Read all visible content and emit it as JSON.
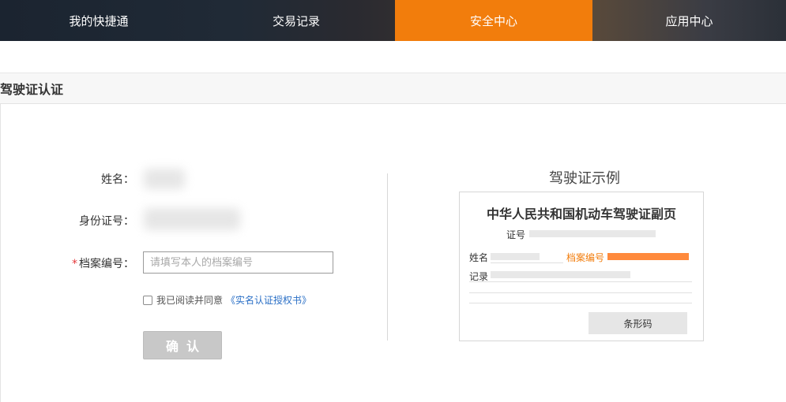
{
  "nav": {
    "tabs": [
      {
        "label": "我的快捷通"
      },
      {
        "label": "交易记录"
      },
      {
        "label": "安全中心"
      },
      {
        "label": "应用中心"
      }
    ],
    "active_index": 2,
    "active_color": "#f27d0c"
  },
  "section": {
    "title": "驾驶证认证"
  },
  "form": {
    "name_label": "姓名：",
    "id_label": "身份证号：",
    "file_label": "档案编号：",
    "required_mark": "*",
    "file_placeholder": "请填写本人的档案编号",
    "agree_text": "我已阅读并同意",
    "agree_link": "《实名认证授权书》",
    "confirm_label": "确认"
  },
  "sample": {
    "title": "驾驶证示例",
    "license_title": "中华人民共和国机动车驾驶证副页",
    "field_id": "证号",
    "field_name": "姓名",
    "field_file": "档案编号",
    "field_record": "记录",
    "barcode_label": "条形码"
  }
}
